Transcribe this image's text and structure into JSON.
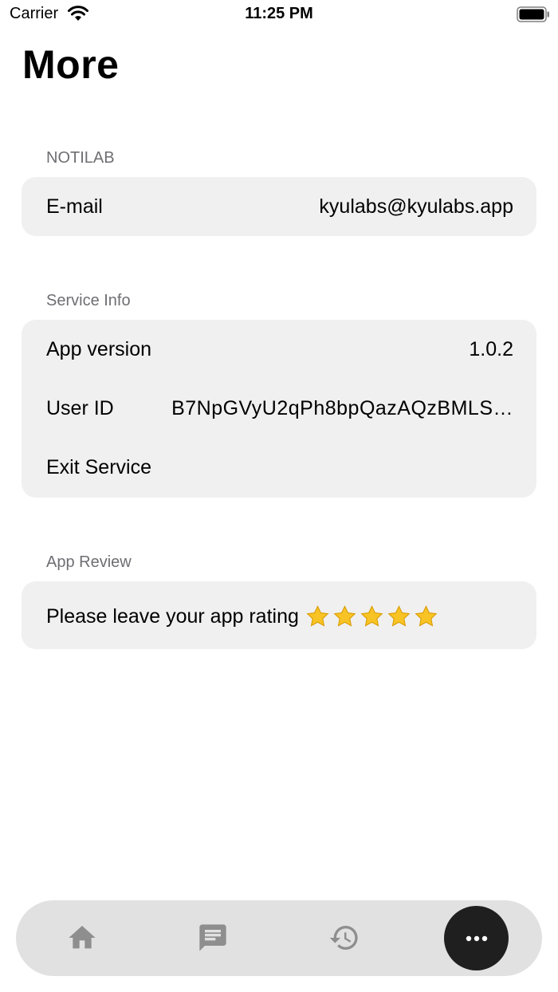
{
  "status_bar": {
    "carrier": "Carrier",
    "time": "11:25 PM"
  },
  "page": {
    "title": "More"
  },
  "sections": {
    "notilab": {
      "header": "NOTILAB",
      "email_label": "E-mail",
      "email_value": "kyulabs@kyulabs.app"
    },
    "service_info": {
      "header": "Service Info",
      "app_version_label": "App version",
      "app_version_value": "1.0.2",
      "user_id_label": "User ID",
      "user_id_value": "B7NpGVyU2qPh8bpQazAQzBMLS…",
      "exit_label": "Exit Service"
    },
    "app_review": {
      "header": "App Review",
      "rating_label": "Please leave your app rating",
      "stars_shown": 5
    }
  },
  "tab_bar": {
    "tabs": [
      {
        "icon": "home-icon",
        "active": false
      },
      {
        "icon": "message-icon",
        "active": false
      },
      {
        "icon": "history-icon",
        "active": false
      },
      {
        "icon": "more-icon",
        "active": true
      }
    ]
  },
  "colors": {
    "card_bg": "#f0f0f0",
    "section_header": "#6e6e73",
    "tab_bar_bg": "#e1e1e1",
    "tab_icon_inactive": "#8e8e8e",
    "tab_active_bg": "#1f1f1f",
    "star": "#f7c325"
  }
}
